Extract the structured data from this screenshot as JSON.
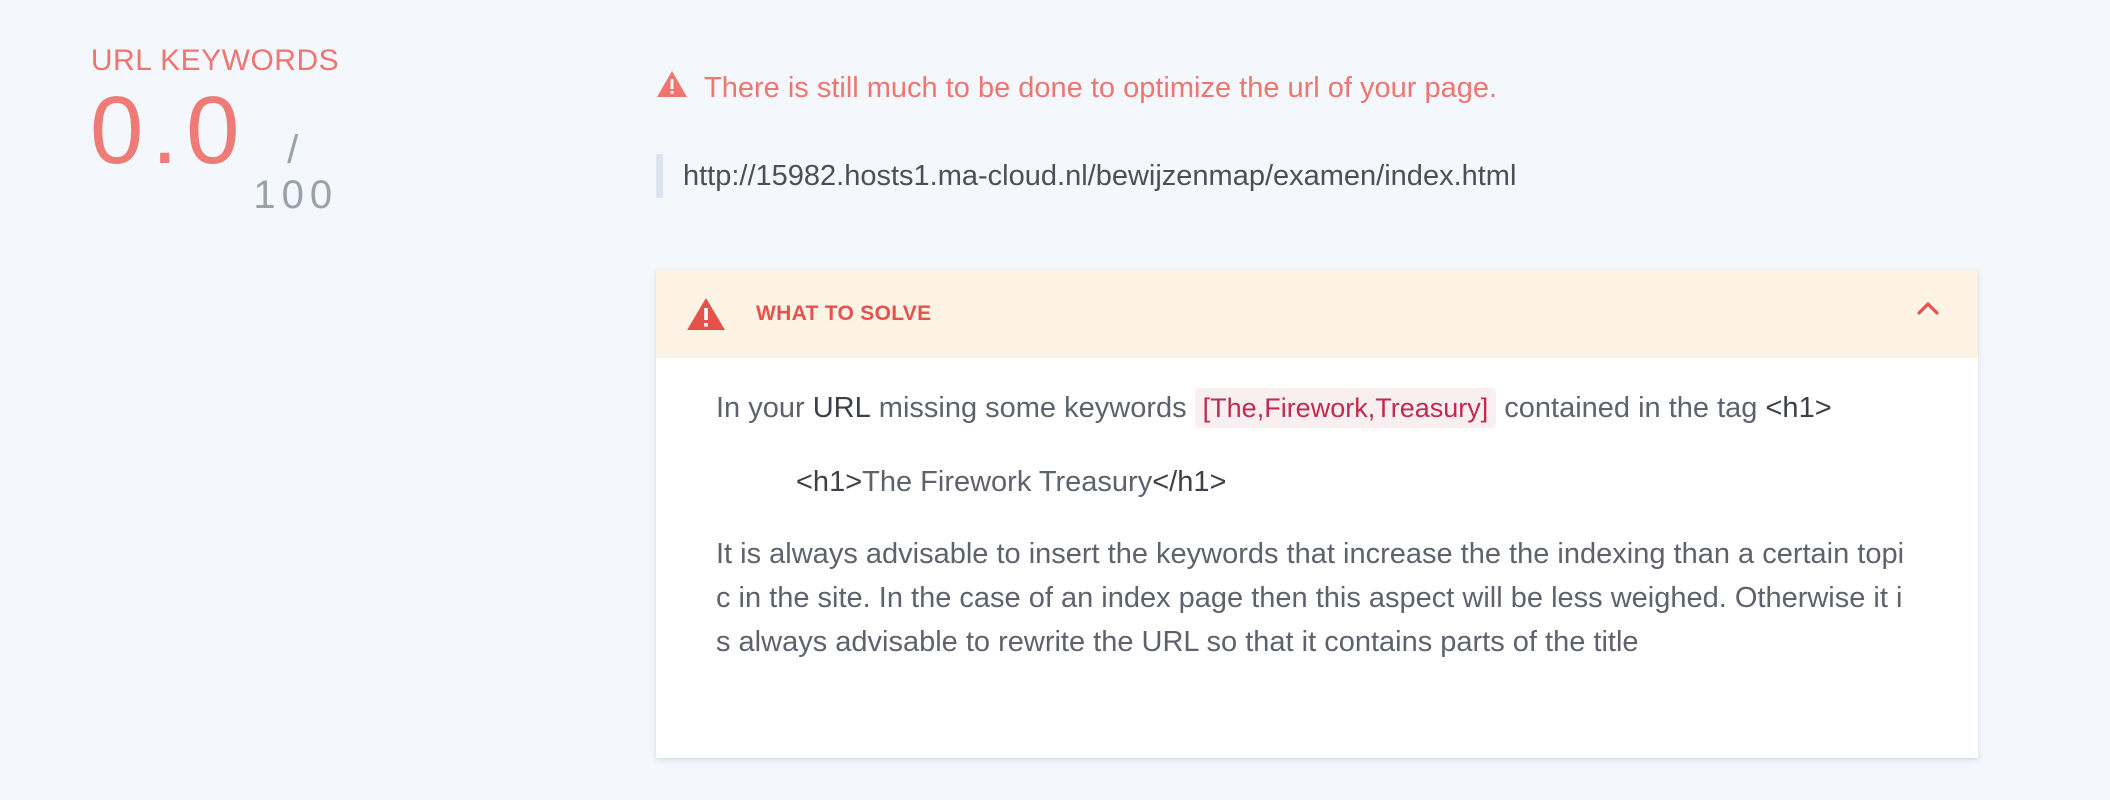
{
  "score": {
    "title": "URL KEYWORDS",
    "value": "0.0",
    "max": "/ 100"
  },
  "warning": {
    "icon": "warning-triangle-icon",
    "text": "There is still much to be done to optimize the url of your page."
  },
  "url": "http://15982.hosts1.ma-cloud.nl/bewijzenmap/examen/index.html",
  "panel": {
    "title": "WHAT TO SOLVE",
    "icon": "alert-triangle-icon",
    "collapse_icon": "chevron-up-icon",
    "intro_prefix": "In your ",
    "intro_url": "URL",
    "intro_mid": " missing some keywords ",
    "keywords": "[The,Firework,Treasury]",
    "intro_suffix": " contained in the tag ",
    "intro_tag": "<h1>",
    "example_open": "<h1>",
    "example_text": "The Firework Treasury",
    "example_close": "</h1>",
    "advice": "It is always advisable to insert the keywords that increase the the indexing than a certain topic in the site. In the case of an index page then this aspect will be less weighed. Otherwise it is always advisable to rewrite the URL so that it contains parts of the title"
  },
  "colors": {
    "accent": "#ee7570",
    "danger": "#e4524b",
    "header_bg": "#fdf3e4",
    "page_bg": "#f4f7fc",
    "keyword": "#c1294e"
  }
}
